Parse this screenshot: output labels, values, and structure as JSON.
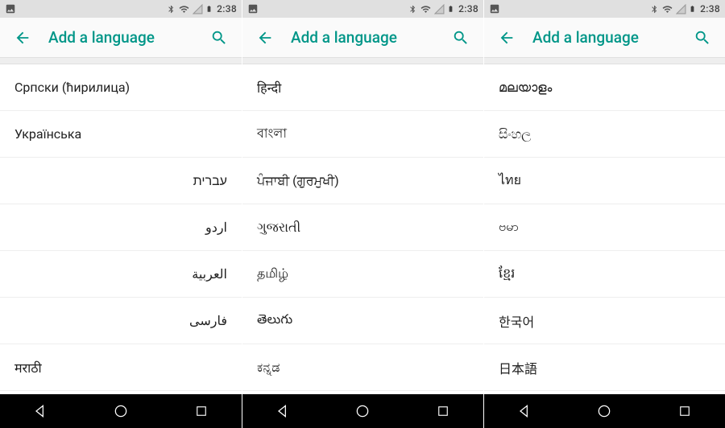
{
  "status": {
    "clock": "2:38"
  },
  "header": {
    "title": "Add a language"
  },
  "screens": [
    {
      "items": [
        {
          "label": "Српски (ћирилица)",
          "rtl": false
        },
        {
          "label": "Українська",
          "rtl": false
        },
        {
          "label": "עברית",
          "rtl": true
        },
        {
          "label": "اردو",
          "rtl": true
        },
        {
          "label": "العربية",
          "rtl": true
        },
        {
          "label": "فارسی",
          "rtl": true
        },
        {
          "label": "मराठी",
          "rtl": false
        }
      ]
    },
    {
      "items": [
        {
          "label": "हिन्दी",
          "rtl": false
        },
        {
          "label": "বাংলা",
          "rtl": false
        },
        {
          "label": "ਪੰਜਾਬੀ (ਗੁਰਮੁਖੀ)",
          "rtl": false
        },
        {
          "label": "ગુજરાતી",
          "rtl": false
        },
        {
          "label": "தமிழ்",
          "rtl": false
        },
        {
          "label": "తెలుగు",
          "rtl": false
        },
        {
          "label": "ಕನ್ನಡ",
          "rtl": false
        }
      ]
    },
    {
      "items": [
        {
          "label": "മലയാളം",
          "rtl": false
        },
        {
          "label": "සිංහල",
          "rtl": false
        },
        {
          "label": "ไทย",
          "rtl": false
        },
        {
          "label": "ဗမာ",
          "rtl": false
        },
        {
          "label": "ខ្មែរ",
          "rtl": false
        },
        {
          "label": "한국어",
          "rtl": false
        },
        {
          "label": "日本語",
          "rtl": false
        }
      ]
    }
  ]
}
